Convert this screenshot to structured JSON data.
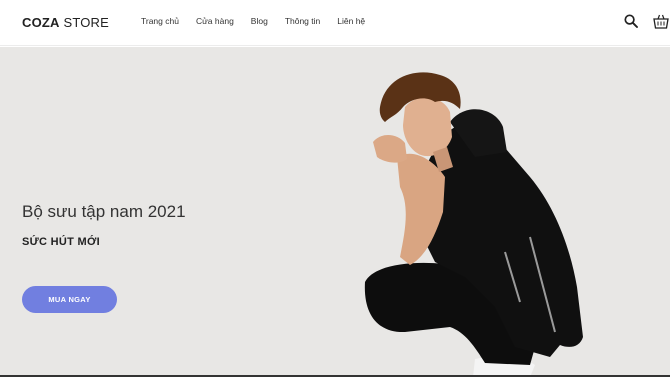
{
  "header": {
    "logo_bold": "COZA",
    "logo_light": " STORE",
    "nav": [
      "Trang chủ",
      "Cửa hàng",
      "Blog",
      "Thông tin",
      "Liên hệ"
    ],
    "icons": [
      "search-icon",
      "cart-icon"
    ]
  },
  "hero": {
    "title": "Bộ sưu tập nam 2021",
    "subtitle": "SỨC HÚT MỚI",
    "cta_label": "MUA NGAY",
    "cta_color": "#717fe0",
    "background_color": "#e8e7e5"
  }
}
